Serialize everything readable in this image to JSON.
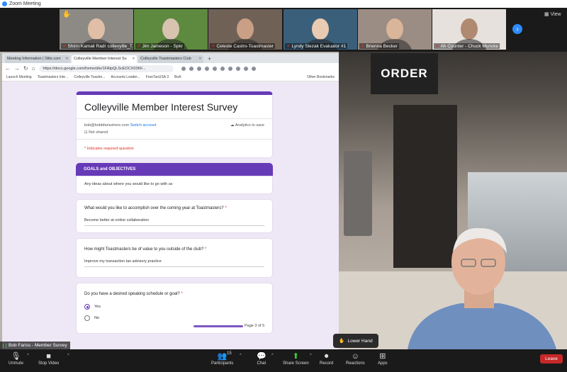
{
  "window": {
    "title": "Zoom Meeting"
  },
  "participants_strip": [
    {
      "name": "Shirin Kamali Radr collevyille_T...",
      "raised_hand": true,
      "bg": "#8d8a86",
      "face": "#e0bfa6"
    },
    {
      "name": "Jim Jameson - Spkr",
      "raised_hand": false,
      "bg": "#5e8a3f",
      "face": "#d7c3b0"
    },
    {
      "name": "Celeste Castro-Toastmaster",
      "raised_hand": false,
      "bg": "#6f6155",
      "face": "#c99f86"
    },
    {
      "name": "Lyndy Slezak Evaluator #1",
      "raised_hand": false,
      "bg": "#3a5f7a",
      "face": "#e8cbb2"
    },
    {
      "name": "Brienna Becker",
      "raised_hand": false,
      "bg": "#9b8c84",
      "face": "#d9b59a"
    },
    {
      "name": "Ah Counter - Chuck Muncke",
      "raised_hand": false,
      "bg": "#e6e1dc",
      "face": "#b08a70"
    }
  ],
  "strip_next_icon": "chevron-right",
  "view_button": {
    "label": "View"
  },
  "browser": {
    "tabs": [
      {
        "label": "Meeting Information | Slite.com",
        "active": false
      },
      {
        "label": "Colleyville Member Interest Su",
        "active": true
      },
      {
        "label": "Colleyville Toastmasters Club",
        "active": false
      }
    ],
    "new_tab": "+",
    "url": "https://docs.google.com/forms/d/e/1FAIpQLScEOCX03KF...",
    "bookmarks": [
      "Launch Meeting",
      "Toastmasters Inte...",
      "Colleyville Toastm...",
      "Accounts Leader...",
      "FreeTaxUSA 3",
      "BoA"
    ],
    "other_bookmarks": "Other Bookmarks"
  },
  "form": {
    "title": "Colleyville Member Interest Survey",
    "account_email": "bob@bobbfarisshere.com",
    "switch_account": "Switch account",
    "draft_status": "Not shared",
    "cloud_status": "Analytics to save",
    "required_note": "* Indicates required question",
    "section": {
      "title": "GOALS and OBJECTIVES",
      "description": "Any ideas about where you would like to go with us"
    },
    "questions": [
      {
        "text": "What would you like to accomplish over the coming year at Toastmasters?",
        "required": true,
        "answer": "Become better at online collaboration"
      },
      {
        "text": "How might Toastmasters be of value to you outside of the club?",
        "required": true,
        "answer": "Improve my transaction tax advisory practice"
      },
      {
        "text": "Do you have a desired speaking schedule or goal?",
        "required": true,
        "options": [
          {
            "label": "Yes",
            "selected": true
          },
          {
            "label": "No",
            "selected": false
          }
        ]
      }
    ],
    "page_indicator": "Page 3 of 5",
    "page_progress": 0.6
  },
  "scene": {
    "sign_text": "ORDER"
  },
  "share_label": "Bob Fariss - Member Survey",
  "lower_hand": {
    "label": "Lower Hand"
  },
  "toolbar": {
    "unmute": "Unmute",
    "stop_video": "Stop Video",
    "participants": "Participants",
    "participants_count": "15",
    "chat": "Chat",
    "share_screen": "Share Screen",
    "record": "Record",
    "reactions": "Reactions",
    "apps": "Apps",
    "leave": "Leave"
  },
  "colors": {
    "form_accent": "#673ab7",
    "zoom_blue": "#2d8cff",
    "leave_red": "#c62828",
    "share_green": "#3dd13d"
  }
}
